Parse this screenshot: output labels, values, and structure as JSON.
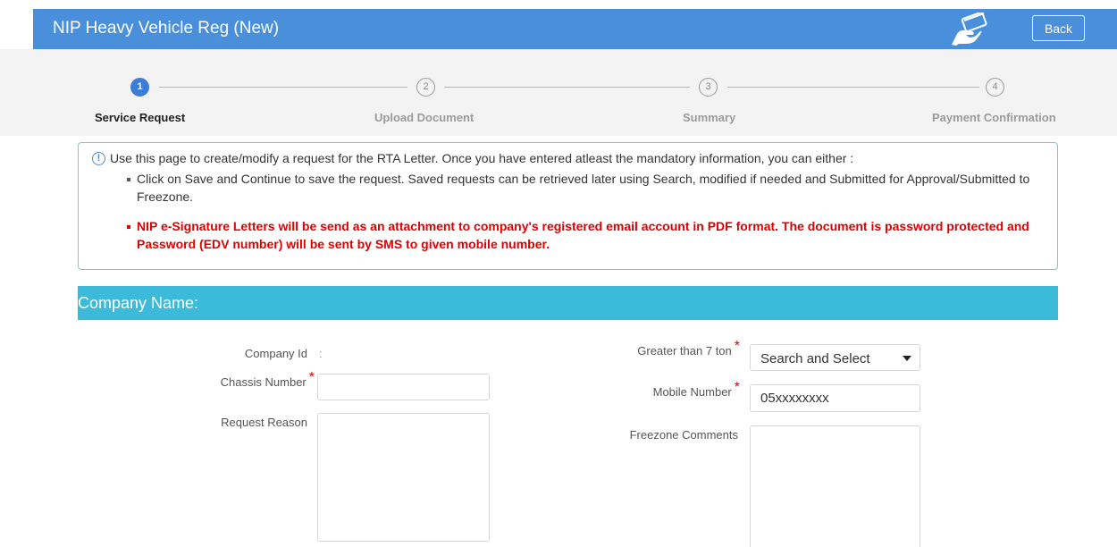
{
  "header": {
    "title": "NIP Heavy Vehicle Reg (New)",
    "back_label": "Back",
    "icon": "card-payment-icon"
  },
  "steps": [
    {
      "number": "1",
      "label": "Service Request",
      "active": true
    },
    {
      "number": "2",
      "label": "Upload Document",
      "active": false
    },
    {
      "number": "3",
      "label": "Summary",
      "active": false
    },
    {
      "number": "4",
      "label": "Payment Confirmation",
      "active": false
    }
  ],
  "info": {
    "intro": "Use this page to create/modify a request for the RTA Letter. Once you have entered atleast the mandatory information, you can either :",
    "bullet_1": "Click on Save and Continue to save the request. Saved requests can be retrieved later using Search, modified if needed and Submitted for Approval/Submitted to Freezone.",
    "bullet_2": "NIP e-Signature Letters will be send as an attachment to company's registered email account in PDF format. The document is password protected and Password (EDV number) will be sent by SMS to given mobile number."
  },
  "section": {
    "title": "Company Name:"
  },
  "form": {
    "company_id_label": "Company Id",
    "company_id_value": ":",
    "chassis_label": "Chassis Number",
    "chassis_value": "",
    "reason_label": "Request Reason",
    "reason_value": "",
    "ton_label": "Greater than 7 ton",
    "ton_value": "Search and Select",
    "mobile_label": "Mobile Number",
    "mobile_value": "05xxxxxxxx",
    "comments_label": "Freezone Comments",
    "comments_value": "",
    "required_mark": "*"
  },
  "colors": {
    "header_bg": "#4a8fdb",
    "section_bg": "#3bbad9",
    "active_step": "#3b7dd8",
    "warning_text": "#e00000"
  }
}
